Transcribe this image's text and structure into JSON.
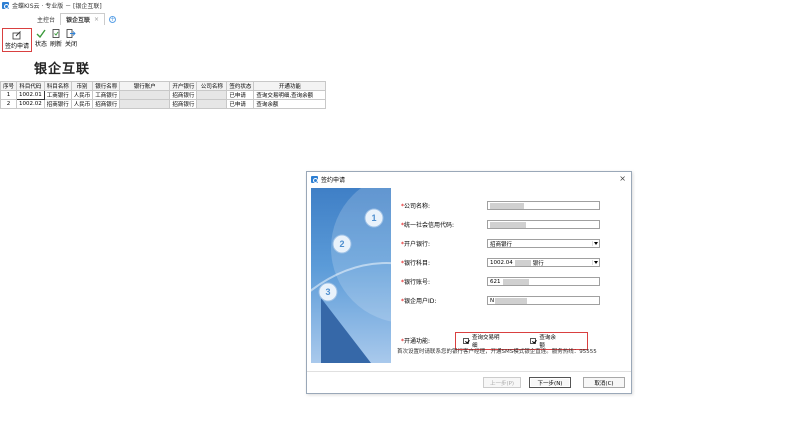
{
  "window": {
    "title": "金蝶KIS云 · 专业版 － [银企互联]"
  },
  "tabs": [
    {
      "label": "主控台"
    },
    {
      "label": "银企互联",
      "close": "×"
    }
  ],
  "toolbar": {
    "sign": "签约申请",
    "status": "状态",
    "refresh": "刷新",
    "close": "关闭"
  },
  "page": {
    "title": "银企互联"
  },
  "table": {
    "headers": [
      "序号",
      "科目代码",
      "科目名称",
      "币别",
      "银行名称",
      "银行账户",
      "开户银行",
      "公司名称",
      "签约状态",
      "开通功能"
    ],
    "rows": [
      [
        "1",
        "1002.01",
        "工商银行",
        "人民币",
        "工商银行",
        "",
        "招商银行",
        "",
        "已申请",
        "查询交易明细,查询余额"
      ],
      [
        "2",
        "1002.02",
        "招商银行",
        "人民币",
        "招商银行",
        "",
        "招商银行",
        "",
        "已申请",
        "查询余额"
      ]
    ]
  },
  "dialog": {
    "title": "签约申请",
    "close": "×",
    "labels": {
      "company": "公司名称:",
      "credit": "统一社会信用代码:",
      "open_bank": "开户银行:",
      "bank_subject": "银行科目:",
      "bank_account": "银行账号:",
      "ent_user": "银企用户ID:",
      "functions": "开通功能:"
    },
    "required_mark": "*",
    "values": {
      "open_bank": "招商银行",
      "bank_subject_code": "1002.04",
      "bank_subject_name": "银行",
      "bank_account": "621",
      "ent_user": "N"
    },
    "functions": [
      {
        "label": "查询交易明细",
        "checked": true
      },
      {
        "label": "查询余额",
        "checked": true
      }
    ],
    "hint": "首次设置时请联系您的银行客户经理，开通SMS模式银企直连。服务热线：95555",
    "buttons": {
      "prev": "上一步(P)",
      "next": "下一步(N)",
      "cancel": "取消(C)"
    },
    "step_numbers": [
      "1",
      "2",
      "3"
    ]
  },
  "colors": {
    "highlight": "#d94040",
    "accent": "#2d7fd3"
  }
}
